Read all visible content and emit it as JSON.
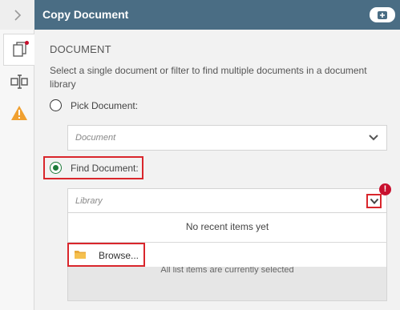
{
  "header": {
    "title": "Copy Document"
  },
  "rail": {
    "tabs": [
      "document-tab",
      "field-tab",
      "warning-tab"
    ]
  },
  "section": {
    "title": "DOCUMENT",
    "description": "Select a single document or filter to find multiple documents in a document library"
  },
  "pick_document": {
    "label": "Pick Document:",
    "checked": false,
    "placeholder": "Document"
  },
  "find_document": {
    "label": "Find Document:",
    "checked": true,
    "library_placeholder": "Library"
  },
  "dropdown": {
    "empty_message": "No recent items yet",
    "browse_label": "Browse..."
  },
  "status": {
    "selection_note": "All list items are currently selected"
  },
  "colors": {
    "header": "#4a6d84",
    "accent_green": "#1e7b3a",
    "highlight_red": "#d9262c",
    "warning_orange": "#f0a030",
    "error_red": "#c8102e"
  }
}
